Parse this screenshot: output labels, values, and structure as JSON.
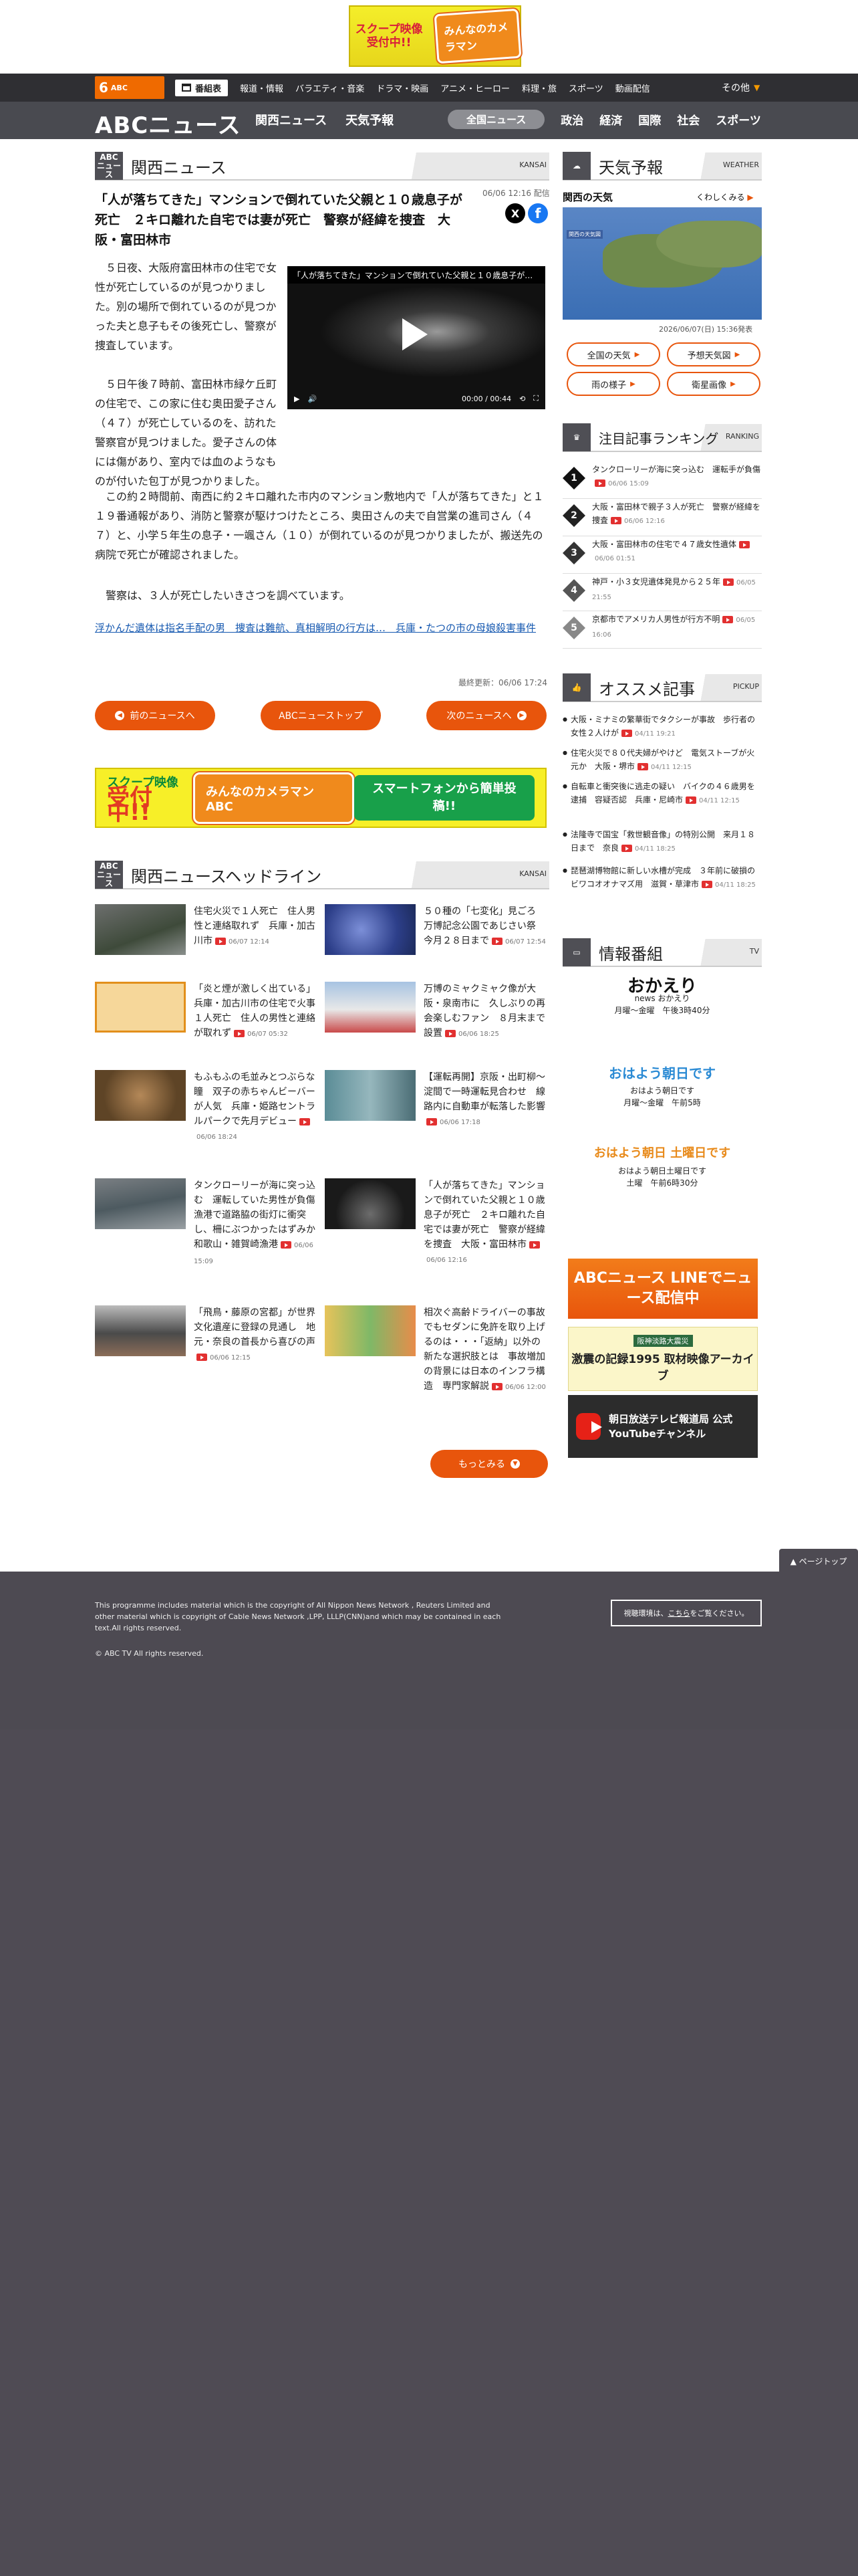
{
  "top_banner": {
    "left": "スクープ映像受付中!!",
    "right": "みんなのカメラマン"
  },
  "global_nav": {
    "logo": "6",
    "logo_sub": "ABC",
    "tvguide": "番組表",
    "items": [
      "報道・情報",
      "バラエティ・音楽",
      "ドラマ・映画",
      "アニメ・ヒーロー",
      "料理・旅",
      "スポーツ",
      "動画配信"
    ],
    "other": "その他"
  },
  "site_header": {
    "logo": "ABCニュース",
    "left": [
      "関西ニュース",
      "天気予報"
    ],
    "pill": "全国ニュース",
    "right": [
      "政治",
      "経済",
      "国際",
      "社会",
      "スポーツ"
    ]
  },
  "kansai": {
    "logo": "ABC ニュース",
    "title": "関西ニュース",
    "en": "KANSAI"
  },
  "article": {
    "date": "06/06 12:16 配信",
    "title": "「人が落ちてきた」マンションで倒れていた父親と１０歳息子が死亡　２キロ離れた自宅では妻が死亡　警察が経緯を捜査　大阪・富田林市",
    "share_x": "X",
    "share_fb": "f",
    "para1": "５日夜、大阪府富田林市の住宅で女性が死亡しているのが見つかりました。別の場所で倒れているのが見つかった夫と息子もその後死亡し、警察が捜査しています。",
    "para2a": "５日午後７時前、富田林市緑ケ丘町の住宅で、この家に住む奥田愛子さん（４７）が死亡しているのを、訪れた警察官が見つけました。愛子さんの体には傷があり、室内では血のようなものが付いた包丁が見つかりました。",
    "para3": "この約２時間前、南西に約２キロ離れた市内のマンション敷地内で「人が落ちてきた」と１１９番通報があり、消防と警察が駆けつけたところ、奥田さんの夫で自営業の進司さん（４７）と、小学５年生の息子・一颯さん（１０）が倒れているのが見つかりましたが、搬送先の病院で死亡が確認されました。",
    "para4": "警察は、３人が死亡したいきさつを調べています。",
    "related": "浮かんだ遺体は指名手配の男　捜査は難航、真相解明の行方は…　兵庫・たつの市の母娘殺害事件",
    "updated": "最終更新：06/06 17:24"
  },
  "video": {
    "title": "「人が落ちてきた」マンションで倒れていた父親と１０歳息子が…",
    "time": "00:00 / 00:44"
  },
  "article_nav": {
    "prev": "前のニュースへ",
    "top": "ABCニューストップ",
    "next": "次のニュースへ"
  },
  "mid_banner": {
    "left_top": "スクープ映像",
    "left_big": "受付中!!",
    "center": "みんなのカメラマン ABC",
    "right": "スマートフォンから簡単投稿!!"
  },
  "headline_section": {
    "logo": "ABC ニュース",
    "title": "関西ニュースヘッドライン",
    "en": "KANSAI"
  },
  "headlines": [
    {
      "text": "住宅火災で１人死亡　住人男性と連絡取れず　兵庫・加古川市",
      "date": "06/07 12:14"
    },
    {
      "text": "５０種の「七変化」見ごろ　万博記念公園であじさい祭　今月２８日まで",
      "date": "06/07 12:54"
    },
    {
      "text": "「炎と煙が激しく出ている」兵庫・加古川市の住宅で火事１人死亡　住人の男性と連絡が取れず",
      "date": "06/07 05:32"
    },
    {
      "text": "万博のミャクミャク像が大阪・泉南市に　久しぶりの再会楽しむファン　８月末まで設置",
      "date": "06/06 18:25"
    },
    {
      "text": "もふもふの毛並みとつぶらな瞳　双子の赤ちゃんビーバーが人気　兵庫・姫路セントラルパークで先月デビュー",
      "date": "06/06 18:24"
    },
    {
      "text": "【運転再開】京阪・出町柳～淀間で一時運転見合わせ　線路内に自動車が転落した影響",
      "date": "06/06 17:18"
    },
    {
      "text": "タンクローリーが海に突っ込む　運転していた男性が負傷　漁港で道路脇の街灯に衝突し、柵にぶつかったはずみか　和歌山・雑賀崎漁港",
      "date": "06/06 15:09"
    },
    {
      "text": "「人が落ちてきた」マンションで倒れていた父親と１０歳息子が死亡　２キロ離れた自宅では妻が死亡　警察が経緯を捜査　大阪・富田林市",
      "date": "06/06 12:16"
    },
    {
      "text": "「飛鳥・藤原の宮都」が世界文化遺産に登録の見通し　地元・奈良の首長から喜びの声",
      "date": "06/06 12:15"
    },
    {
      "text": "相次ぐ高齢ドライバーの事故　でもセダンに免許を取り上げるのは・・・「返納」以外の新たな選択肢とは　事故増加の背景には日本のインフラ構造　専門家解説",
      "date": "06/06 12:00"
    }
  ],
  "more_button": "もっとみる",
  "weather": {
    "title": "天気予報",
    "en": "WEATHER",
    "region": "関西の天気",
    "detail": "くわしくみる",
    "map_label": "関西の天気図",
    "updated": "2026/06/07(日) 15:36発表",
    "buttons": [
      "全国の天気",
      "予想天気図",
      "雨の様子",
      "衛星画像"
    ]
  },
  "ranking": {
    "title": "注目記事ランキング",
    "en": "RANKING",
    "items": [
      {
        "num": "1",
        "text": "タンクローリーが海に突っ込む　運転手が負傷",
        "date": "06/06 15:09"
      },
      {
        "num": "2",
        "text": "大阪・富田林で親子３人が死亡　警察が経緯を捜査",
        "date": "06/06 12:16"
      },
      {
        "num": "3",
        "text": "大阪・富田林市の住宅で４７歳女性遺体",
        "date": "06/06 01:51"
      },
      {
        "num": "4",
        "text": "神戸・小３女児遺体発見から２５年",
        "date": "06/05 21:55"
      },
      {
        "num": "5",
        "text": "京都市でアメリカ人男性が行方不明",
        "date": "06/05 16:06"
      }
    ]
  },
  "pickup": {
    "title": "オススメ記事",
    "en": "PICKUP",
    "items": [
      {
        "text": "大阪・ミナミの繁華街でタクシーが事故　歩行者の女性２人けが",
        "date": "04/11 19:21"
      },
      {
        "text": "住宅火災で８０代夫婦がやけど　電気ストーブが火元か　大阪・堺市",
        "date": "04/11 12:15"
      },
      {
        "text": "自転車と衝突後に逃走の疑い　バイクの４６歳男を逮捕　容疑否認　兵庫・尼崎市",
        "date": "04/11 12:15"
      },
      {
        "text": "法隆寺で国宝「救世観音像」の特別公開　来月１８日まで　奈良",
        "date": "04/11 18:25"
      },
      {
        "text": "琵琶湖博物館に新しい水槽が完成　３年前に破損のビワコオオナマズ用　滋賀・草津市",
        "date": "04/11 18:25"
      }
    ]
  },
  "programs": {
    "title": "情報番組",
    "en": "TV",
    "items": [
      {
        "logo": "おかえり",
        "name": "news おかえり",
        "time": "月曜～金曜　午後3時40分"
      },
      {
        "logo": "おはよう朝日です",
        "name": "おはよう朝日です",
        "time": "月曜～金曜　午前5時"
      },
      {
        "logo": "おはよう朝日 土曜日です",
        "name": "おはよう朝日土曜日です",
        "time": "土曜　午前6時30分"
      }
    ]
  },
  "side_banners": {
    "line": "ABCニュース LINEでニュース配信中",
    "archive_top": "阪神淡路大震災",
    "archive": "激震の記録1995 取材映像アーカイブ",
    "youtube": "朝日放送テレビ報道局 公式YouTubeチャンネル"
  },
  "footer": {
    "pagetop": "▲ ページトップ",
    "copy": "This programme includes material which is the copyright of All Nippon News Network , Reuters Limited and other material which is copyright of Cable News Network ,LPP, LLLP(CNN)and which may be contained in each text.All rights reserved.",
    "rights": "© ABC TV All rights reserved.",
    "contact_pre": "視聴環境は、",
    "contact_link": "こちら",
    "contact_post": "をご覧ください。"
  }
}
